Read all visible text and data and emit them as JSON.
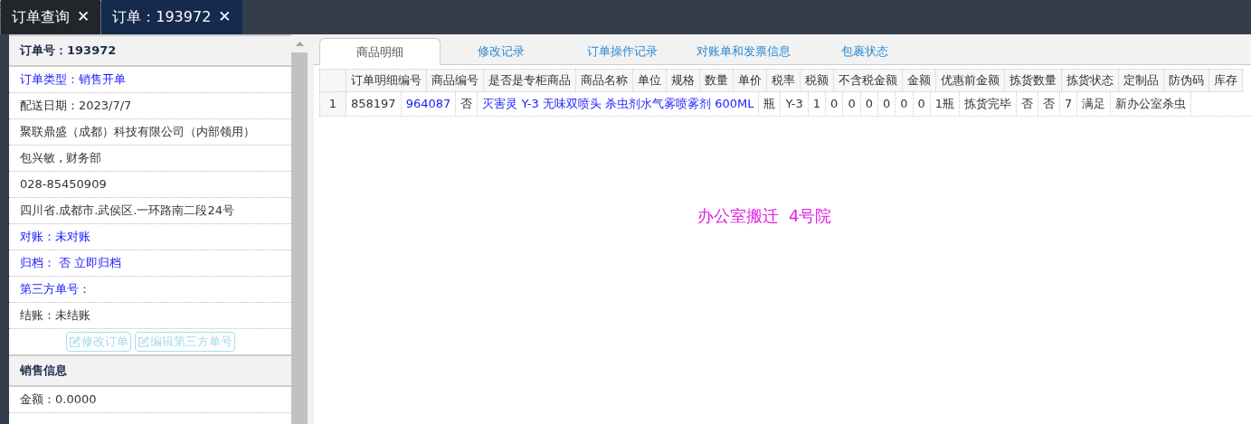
{
  "tabs": [
    {
      "label": "订单查询",
      "selected": false,
      "close": "✕"
    },
    {
      "label": "订单：193972",
      "selected": true,
      "close": "✕"
    }
  ],
  "sidebar": {
    "title": "订单号：193972",
    "rows": [
      {
        "kind": "link",
        "text": "订单类型：销售开单"
      },
      {
        "kind": "text",
        "text": "配送日期：2023/7/7"
      },
      {
        "kind": "text",
        "text": "聚联鼎盛（成都）科技有限公司（内部领用）"
      },
      {
        "kind": "text",
        "text": "包兴敏 , 财务部"
      },
      {
        "kind": "text",
        "text": "028-85450909"
      },
      {
        "kind": "text",
        "text": "四川省.成都市.武侯区.一环路南二段24号"
      },
      {
        "kind": "link",
        "text": "对账：未对账"
      },
      {
        "kind": "action",
        "text": "归档：  否",
        "action": "立即归档"
      },
      {
        "kind": "link",
        "text": "第三方单号："
      },
      {
        "kind": "text",
        "text": "结账：未结账"
      }
    ],
    "buttons": [
      {
        "label": "修改订单",
        "disabled": true
      },
      {
        "label": "编辑第三方单号",
        "disabled": true
      }
    ],
    "section": "销售信息",
    "section_rows": [
      {
        "text": "金额：0.0000"
      }
    ]
  },
  "detail_tabs": [
    {
      "label": "商品明细",
      "selected": true
    },
    {
      "label": "修改记录",
      "selected": false
    },
    {
      "label": "订单操作记录",
      "selected": false
    },
    {
      "label": "对账单和发票信息",
      "selected": false
    },
    {
      "label": "包裹状态",
      "selected": false
    }
  ],
  "header_strip": {
    "labels": [
      "订单明细编号",
      "商品编号",
      "是否是专柜商品",
      "商品名称",
      "单位",
      "规格",
      "数量",
      "单价",
      "税率",
      "税额",
      "不含税金额",
      "金额",
      "优惠前金额",
      "拣货数量",
      "拣货状态",
      "定制品",
      "防伪码",
      "库存"
    ]
  },
  "item_strip": {
    "lines": [
      {
        "number": "1",
        "values": [
          {
            "kind": "text",
            "text": "858197"
          },
          {
            "kind": "link",
            "text": "964087"
          },
          {
            "kind": "text",
            "text": "否"
          },
          {
            "kind": "link",
            "text": "灭害灵 Y-3 无味双喷头 杀虫剂水气雾喷雾剂 600ML"
          },
          {
            "kind": "text",
            "text": "瓶"
          },
          {
            "kind": "text",
            "text": "Y-3"
          },
          {
            "kind": "text",
            "text": "1"
          },
          {
            "kind": "text",
            "text": "0"
          },
          {
            "kind": "text",
            "text": "0"
          },
          {
            "kind": "text",
            "text": "0"
          },
          {
            "kind": "text",
            "text": "0"
          },
          {
            "kind": "text",
            "text": "0"
          },
          {
            "kind": "text",
            "text": "0"
          },
          {
            "kind": "text",
            "text": "1瓶"
          },
          {
            "kind": "text",
            "text": "拣货完毕"
          },
          {
            "kind": "text",
            "text": "否"
          },
          {
            "kind": "text",
            "text": "否"
          },
          {
            "kind": "text",
            "text": "7"
          },
          {
            "kind": "text",
            "text": "满足"
          },
          {
            "kind": "text",
            "text": "新办公室杀虫"
          }
        ]
      }
    ]
  },
  "remark": "办公室搬迁  4号院"
}
